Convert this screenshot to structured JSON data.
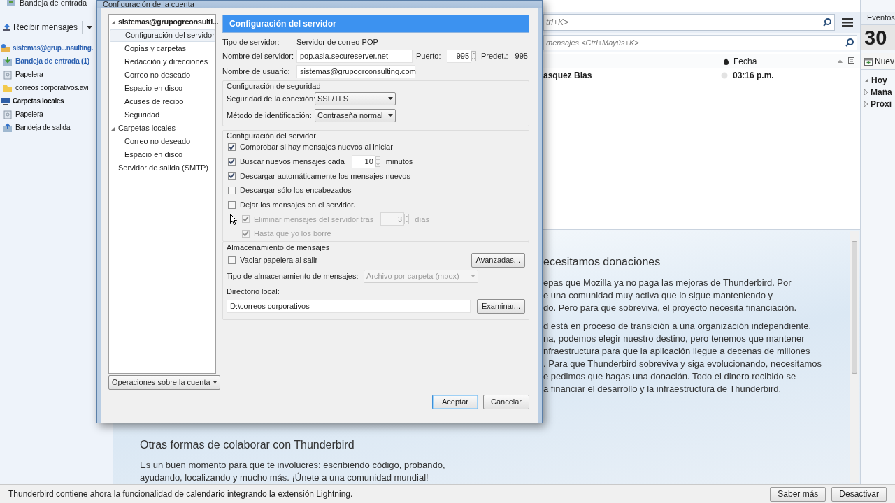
{
  "app": {
    "top_title": "Bandeja de entrada",
    "toolbar": {
      "get_messages": "Recibir mensajes"
    },
    "folders": [
      {
        "label": "sistemas@grup...nsulting.",
        "kind": "account",
        "unread": true,
        "children": [
          {
            "label": "Bandeja de entrada (1)",
            "kind": "inbox",
            "unread": true
          },
          {
            "label": "Papelera",
            "kind": "trash",
            "unread": false
          },
          {
            "label": "correos corporativos.avi",
            "kind": "folder",
            "unread": false
          }
        ]
      },
      {
        "label": "Carpetas locales",
        "kind": "local",
        "unread": false,
        "children": [
          {
            "label": "Papelera",
            "kind": "trash",
            "unread": false
          },
          {
            "label": "Bandeja de salida",
            "kind": "outbox",
            "unread": false
          }
        ]
      }
    ],
    "search": {
      "placeholder": "trl+K>"
    },
    "filter": {
      "placeholder": "mensajes <Ctrl+Mayús+K>"
    },
    "columns": [
      {
        "label": "Fecha"
      }
    ],
    "messages": [
      {
        "sender": "asquez Blas",
        "date": "03:16 p.m."
      }
    ],
    "start_page": {
      "heading": "ecesitamos donaciones",
      "paragraph_1": [
        "epas que Mozilla ya no paga las mejoras de Thunderbird. Por",
        "e una comunidad muy activa que lo sigue manteniendo y",
        "do. Pero para que sobreviva, el proyecto necesita financiación."
      ],
      "paragraph_2": [
        "d está en proceso de transición a una organización independiente.",
        "na, podemos elegir nuestro destino, pero tenemos que mantener",
        "nfraestructura para que la aplicación llegue a decenas de millones",
        ". Para que Thunderbird sobreviva y siga evolucionando, necesitamos",
        "e pedimos que hagas una donación. Todo el dinero recibido se",
        "a financiar el desarrollo y la infraestructura de Thunderbird."
      ],
      "heading_2": "Otras formas de colaborar con Thunderbird",
      "paragraph_3": [
        "Es un buen momento para que te involucres: escribiendo código, probando,",
        "ayudando, localizando y mucho más. ¡Únete a una comunidad mundial!"
      ]
    },
    "today_pane": {
      "tab": "Eventos",
      "day": "30",
      "new_button": "Nuev",
      "sections": [
        {
          "label": "Hoy",
          "expanded": true
        },
        {
          "label": "Maña",
          "expanded": false
        },
        {
          "label": "Próxi",
          "expanded": false
        }
      ]
    },
    "notification": {
      "text": "Thunderbird contiene ahora la funcionalidad de calendario integrando la extensión Lightning.",
      "buttons": [
        "Saber más",
        "Desactivar"
      ]
    }
  },
  "dialog": {
    "title": "Configuración de la cuenta",
    "tree": [
      {
        "label": "sistemas@grupogrconsulti...",
        "selected": false,
        "expanded": true,
        "children": [
          {
            "label": "Configuración del servidor",
            "selected": true
          },
          {
            "label": "Copias y carpetas",
            "selected": false
          },
          {
            "label": "Redacción y direcciones",
            "selected": false
          },
          {
            "label": "Correo no deseado",
            "selected": false
          },
          {
            "label": "Espacio en disco",
            "selected": false
          },
          {
            "label": "Acuses de recibo",
            "selected": false
          },
          {
            "label": "Seguridad",
            "selected": false
          }
        ]
      },
      {
        "label": "Carpetas locales",
        "selected": false,
        "expanded": true,
        "children": [
          {
            "label": "Correo no deseado",
            "selected": false
          },
          {
            "label": "Espacio en disco",
            "selected": false
          }
        ]
      },
      {
        "label": "Servidor de salida (SMTP)",
        "selected": false
      }
    ],
    "account_actions": "Operaciones sobre la cuenta",
    "panel_title": "Configuración del servidor",
    "server_type_label": "Tipo de servidor:",
    "server_type": "Servidor de correo POP",
    "server_name_label": "Nombre del servidor:",
    "server_name": "pop.asia.secureserver.net",
    "port_label": "Puerto:",
    "port": "995",
    "default_label": "Predet.:",
    "default_port": "995",
    "user_label": "Nombre de usuario:",
    "user": "sistemas@grupogrconsulting.com",
    "security": {
      "title": "Configuración de seguridad",
      "rows": [
        {
          "label": "Seguridad de la conexión:",
          "value": "SSL/TLS"
        },
        {
          "label": "Método de identificación:",
          "value": "Contraseña normal"
        }
      ]
    },
    "server": {
      "title": "Configuración del servidor",
      "options": [
        {
          "label": "Comprobar si hay mensajes nuevos al iniciar",
          "checked": true,
          "disabled": false
        },
        {
          "label": "Buscar nuevos mensajes cada",
          "checked": true,
          "disabled": false,
          "spin": "10",
          "suffix": "minutos"
        },
        {
          "label": "Descargar automáticamente los mensajes nuevos",
          "checked": true,
          "disabled": false
        },
        {
          "label": "Descargar sólo los encabezados",
          "checked": false,
          "disabled": false
        },
        {
          "label": "Dejar los mensajes en el servidor.",
          "checked": false,
          "disabled": false,
          "children": [
            {
              "label": "Eliminar mensajes del servidor tras",
              "checked": true,
              "disabled": true,
              "spin": "3",
              "suffix": "días"
            },
            {
              "label": "Hasta que yo los borre",
              "checked": true,
              "disabled": true
            }
          ]
        }
      ]
    },
    "storage": {
      "title": "Almacenamiento de mensajes",
      "empty_trash": {
        "label": "Vaciar papelera al salir",
        "checked": false
      },
      "advanced_button": "Avanzadas...",
      "type_label": "Tipo de almacenamiento de mensajes:",
      "type_value": "Archivo por carpeta (mbox)",
      "type_disabled": true,
      "dir_label": "Directorio local:",
      "dir_value": "D:\\correos corporativos",
      "browse_button": "Examinar..."
    },
    "buttons": [
      {
        "label": "Aceptar",
        "default": true
      },
      {
        "label": "Cancelar",
        "default": false
      }
    ]
  }
}
